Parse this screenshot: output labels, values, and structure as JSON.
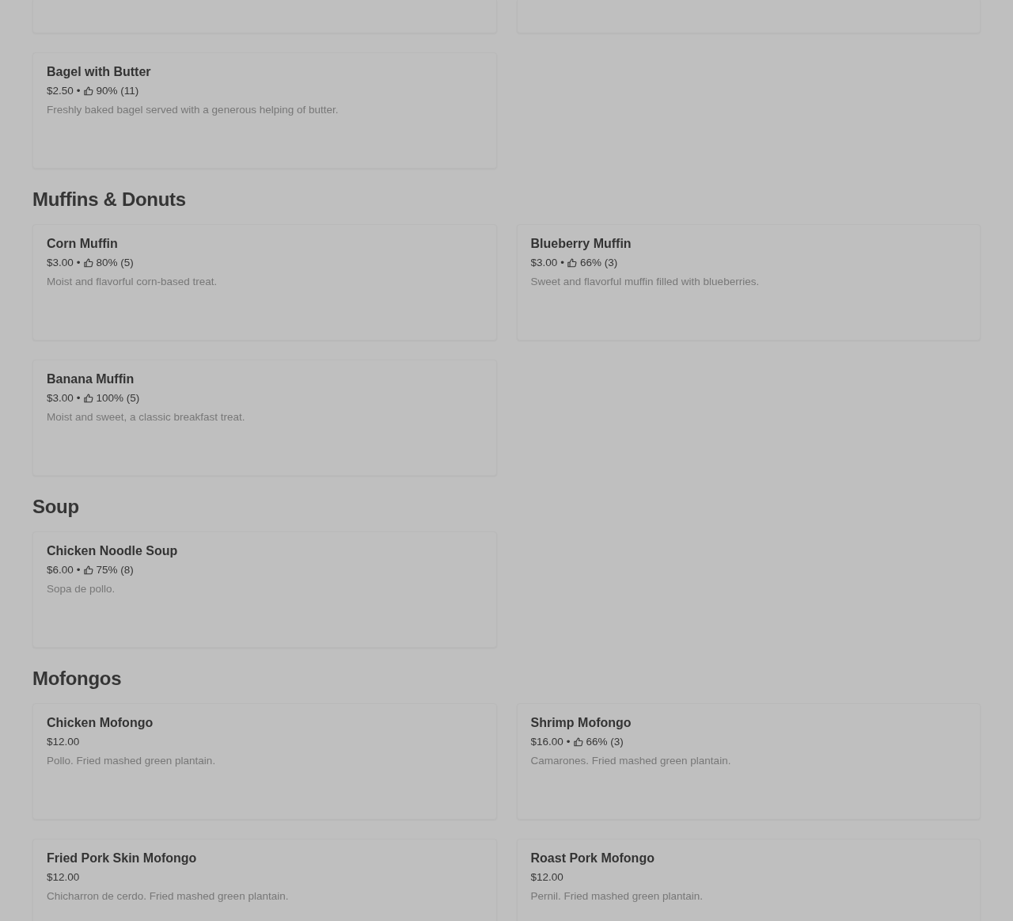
{
  "sections": [
    {
      "items": [
        {
          "kind": "cut_off"
        },
        {
          "kind": "cut_off"
        },
        {
          "kind": "dish",
          "name": "Bagel with Butter",
          "price": "$2.50",
          "separator": "•",
          "rating": "90% (11)",
          "description": "Freshly baked bagel served with a generous helping of butter."
        }
      ]
    },
    {
      "heading": "Muffins & Donuts",
      "items": [
        {
          "kind": "dish",
          "name": "Corn Muffin",
          "price": "$3.00",
          "separator": "•",
          "rating": "80% (5)",
          "description": "Moist and flavorful corn-based treat."
        },
        {
          "kind": "dish",
          "name": "Blueberry Muffin",
          "price": "$3.00",
          "separator": "•",
          "rating": "66% (3)",
          "description": "Sweet and flavorful muffin filled with blueberries."
        },
        {
          "kind": "dish",
          "name": "Banana Muffin",
          "price": "$3.00",
          "separator": "•",
          "rating": "100% (5)",
          "description": "Moist and sweet, a classic breakfast treat."
        }
      ]
    },
    {
      "heading": "Soup",
      "items": [
        {
          "kind": "dish",
          "name": "Chicken Noodle Soup",
          "price": "$6.00",
          "separator": "•",
          "rating": "75% (8)",
          "description": "Sopa de pollo."
        }
      ]
    },
    {
      "heading": "Mofongos",
      "items": [
        {
          "kind": "dish",
          "name": "Chicken Mofongo",
          "price": "$12.00",
          "description": "Pollo. Fried mashed green plantain."
        },
        {
          "kind": "dish",
          "name": "Shrimp Mofongo",
          "price": "$16.00",
          "separator": "•",
          "rating": "66% (3)",
          "description": "Camarones. Fried mashed green plantain."
        },
        {
          "kind": "dish",
          "name": "Fried Pork Skin Mofongo",
          "price": "$12.00",
          "description": "Chicharron de cerdo. Fried mashed green plantain."
        },
        {
          "kind": "dish",
          "name": "Roast Pork Mofongo",
          "price": "$12.00",
          "description": "Pernil. Fried mashed green plantain."
        }
      ]
    }
  ]
}
